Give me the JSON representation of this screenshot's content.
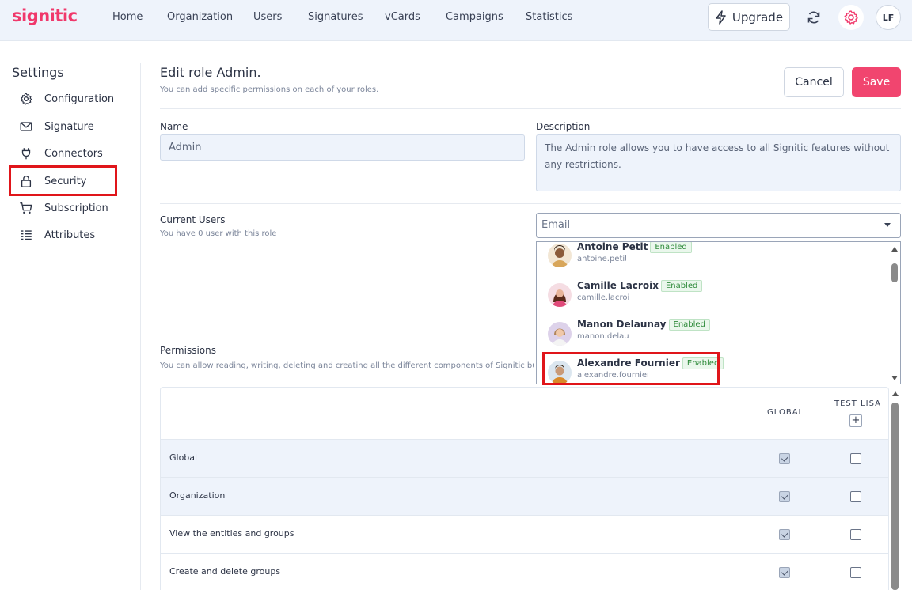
{
  "brand": "signitic",
  "nav": {
    "items": [
      "Home",
      "Organization",
      "Users",
      "Signatures",
      "vCards",
      "Campaigns",
      "Statistics"
    ],
    "upgrade_label": "Upgrade",
    "user_initials": "LF"
  },
  "sidebar": {
    "title": "Settings",
    "items": [
      {
        "label": "Configuration",
        "icon": "gear-icon"
      },
      {
        "label": "Signature",
        "icon": "envelope-icon"
      },
      {
        "label": "Connectors",
        "icon": "plug-icon"
      },
      {
        "label": "Security",
        "icon": "lock-icon",
        "selected": true
      },
      {
        "label": "Subscription",
        "icon": "cart-icon"
      },
      {
        "label": "Attributes",
        "icon": "list-icon"
      }
    ]
  },
  "header": {
    "title": "Edit role Admin.",
    "subtitle": "You can add specific permissions on each of your roles.",
    "cancel_label": "Cancel",
    "save_label": "Save"
  },
  "form": {
    "name_label": "Name",
    "name_value": "Admin",
    "description_label": "Description",
    "description_value": "The Admin role allows you to have access to all Signitic features without any restrictions.",
    "current_users_label": "Current Users",
    "current_users_sub": "You have 0 user with this role",
    "email_placeholder": "Email"
  },
  "user_dropdown": [
    {
      "name": "Antoine Petit",
      "status": "Enabled",
      "email": "antoine.petit"
    },
    {
      "name": "Camille Lacroix",
      "status": "Enabled",
      "email": "camille.lacroix"
    },
    {
      "name": "Manon Delaunay",
      "status": "Enabled",
      "email": "manon.delaunay"
    },
    {
      "name": "Alexandre Fournier",
      "status": "Enabled",
      "email": "alexandre.fournier"
    }
  ],
  "permissions": {
    "label": "Permissions",
    "sub": "You can allow reading, writing, deleting and creating all the different components of Signitic but also s",
    "col_global": "GLOBAL",
    "col_test": "TEST LISA",
    "add_symbol": "+",
    "rows": [
      {
        "label": "Global",
        "global": true,
        "test": false
      },
      {
        "label": "Organization",
        "global": true,
        "test": false
      },
      {
        "label": "View the entities and groups",
        "global": true,
        "test": false
      },
      {
        "label": "Create and delete groups",
        "global": true,
        "test": false
      }
    ]
  },
  "colors": {
    "brand": "#f0386b",
    "save": "#f1456f",
    "highlight_box": "#e0151a",
    "enabled_badge": "#2e8a3a"
  }
}
